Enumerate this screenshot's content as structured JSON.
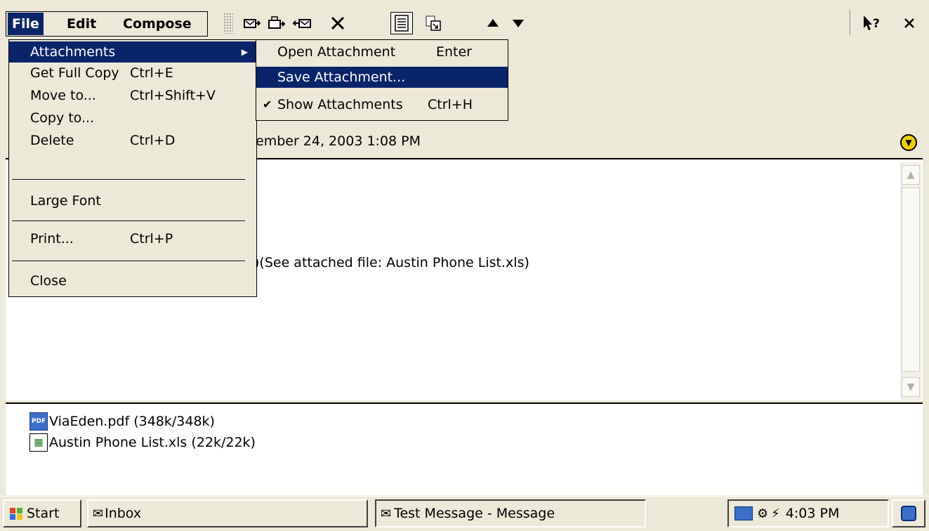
{
  "menubar": {
    "file": "File",
    "edit": "Edit",
    "compose": "Compose"
  },
  "toolbar": {
    "icons": [
      "reply-icon",
      "reply-all-icon",
      "forward-icon",
      "delete-icon",
      "message-view-icon",
      "download-icon",
      "previous-icon",
      "next-icon",
      "help-icon",
      "close-icon"
    ]
  },
  "file_menu": {
    "items": [
      {
        "label": "Attachments",
        "shortcut": ""
      },
      {
        "label": "Get Full Copy",
        "shortcut": "Ctrl+E"
      },
      {
        "label": "Move to...",
        "shortcut": "Ctrl+Shift+V"
      },
      {
        "label": "Copy to...",
        "shortcut": ""
      },
      {
        "label": "Delete",
        "shortcut": "Ctrl+D"
      },
      {
        "label": "Large Font",
        "shortcut": ""
      },
      {
        "label": "Print...",
        "shortcut": "Ctrl+P"
      },
      {
        "label": "Close",
        "shortcut": ""
      }
    ]
  },
  "attachments_submenu": {
    "items": [
      {
        "label": "Open Attachment",
        "shortcut": "Enter"
      },
      {
        "label": "Save Attachment...",
        "shortcut": ""
      },
      {
        "label": "Show Attachments",
        "shortcut": "Ctrl+H",
        "checked": true
      }
    ]
  },
  "message": {
    "date_fragment": "ember 24, 2003 1:08 PM",
    "body_fragment": ")(See attached file: Austin Phone List.xls)"
  },
  "attachments": [
    {
      "name": "ViaEden.pdf (348k/348k)",
      "icon": "pdf-icon"
    },
    {
      "name": "Austin Phone List.xls (22k/22k)",
      "icon": "excel-icon"
    }
  ],
  "taskbar": {
    "start": "Start",
    "inbox": "Inbox",
    "active_window": "Test Message - Message",
    "clock": "4:03 PM"
  },
  "colors": {
    "face": "#ece9d8",
    "selection": "#0a246a"
  }
}
